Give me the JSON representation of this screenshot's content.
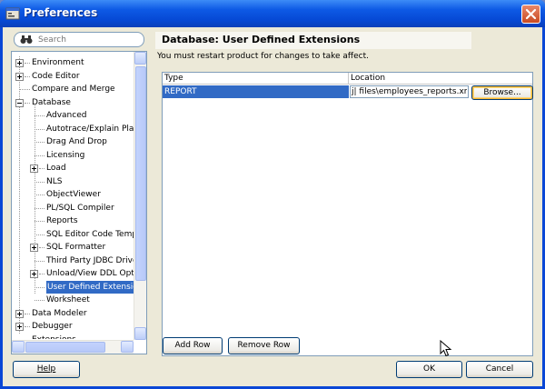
{
  "window": {
    "title": "Preferences",
    "icons": {
      "app": "preferences-icon",
      "close": "close-icon"
    }
  },
  "search": {
    "placeholder": "Search",
    "value": "",
    "icon": "search-binoculars-icon"
  },
  "tree": {
    "items": [
      {
        "label": "Environment",
        "expandable": true
      },
      {
        "label": "Code Editor",
        "expandable": true
      },
      {
        "label": "Compare and Merge",
        "expandable": false
      },
      {
        "label": "Database",
        "expandable": true,
        "expanded": true
      },
      {
        "label": "Advanced",
        "expandable": false
      },
      {
        "label": "Autotrace/Explain Plan",
        "expandable": false
      },
      {
        "label": "Drag And Drop",
        "expandable": false
      },
      {
        "label": "Licensing",
        "expandable": false
      },
      {
        "label": "Load",
        "expandable": true
      },
      {
        "label": "NLS",
        "expandable": false
      },
      {
        "label": "ObjectViewer",
        "expandable": false
      },
      {
        "label": "PL/SQL Compiler",
        "expandable": false
      },
      {
        "label": "Reports",
        "expandable": false
      },
      {
        "label": "SQL Editor Code Templa",
        "expandable": false
      },
      {
        "label": "SQL Formatter",
        "expandable": true
      },
      {
        "label": "Third Party JDBC Driver",
        "expandable": false
      },
      {
        "label": "Unload/View DDL Option",
        "expandable": true
      },
      {
        "label": "User Defined Extension",
        "expandable": false,
        "selected": true
      },
      {
        "label": "Worksheet",
        "expandable": false
      },
      {
        "label": "Data Modeler",
        "expandable": true
      },
      {
        "label": "Debugger",
        "expandable": true
      },
      {
        "label": "Extensions",
        "expandable": false
      }
    ]
  },
  "page": {
    "title": "Database: User Defined Extensions",
    "note": "You must restart product for changes to take affect."
  },
  "table": {
    "columns": [
      "Type",
      "Location"
    ],
    "rows": [
      {
        "type": "REPORT",
        "location": "\\files\\employees_reports.xml",
        "location_shown": "j| files\\employees_reports.xml"
      }
    ],
    "browse_label": "Browse..."
  },
  "buttons": {
    "add_row": "Add Row",
    "remove_row": "Remove Row",
    "help": "Help",
    "ok": "OK",
    "cancel": "Cancel"
  },
  "colors": {
    "title_bar": "#0a47d6",
    "client_bg": "#ece9d8",
    "selection": "#316ac5",
    "close_button": "#c94a22"
  }
}
